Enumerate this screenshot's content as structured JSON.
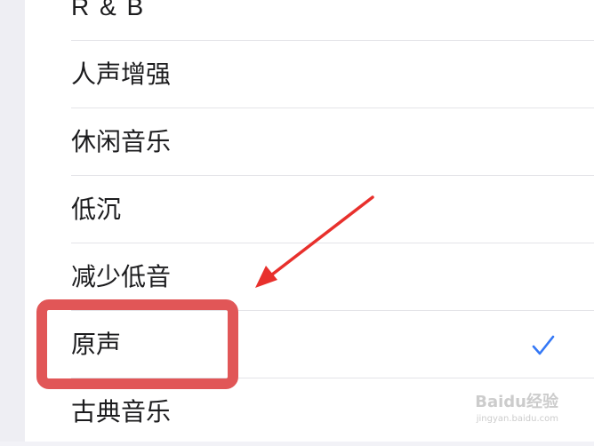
{
  "list": {
    "items": [
      {
        "label": "R & B",
        "selected": false
      },
      {
        "label": "人声增强",
        "selected": false
      },
      {
        "label": "休闲音乐",
        "selected": false
      },
      {
        "label": "低沉",
        "selected": false
      },
      {
        "label": "减少低音",
        "selected": false
      },
      {
        "label": "原声",
        "selected": true
      },
      {
        "label": "古典音乐",
        "selected": false
      }
    ],
    "selected_icon": "checkmark-icon"
  },
  "annotation": {
    "highlight_color": "#e15657",
    "arrow_color": "#e8302c"
  },
  "colors": {
    "accent": "#3478f6",
    "text": "#1c1c1e",
    "background": "#ffffff"
  },
  "watermark": {
    "brand": "Baidu经验",
    "site": "jingyan.baidu.com"
  }
}
